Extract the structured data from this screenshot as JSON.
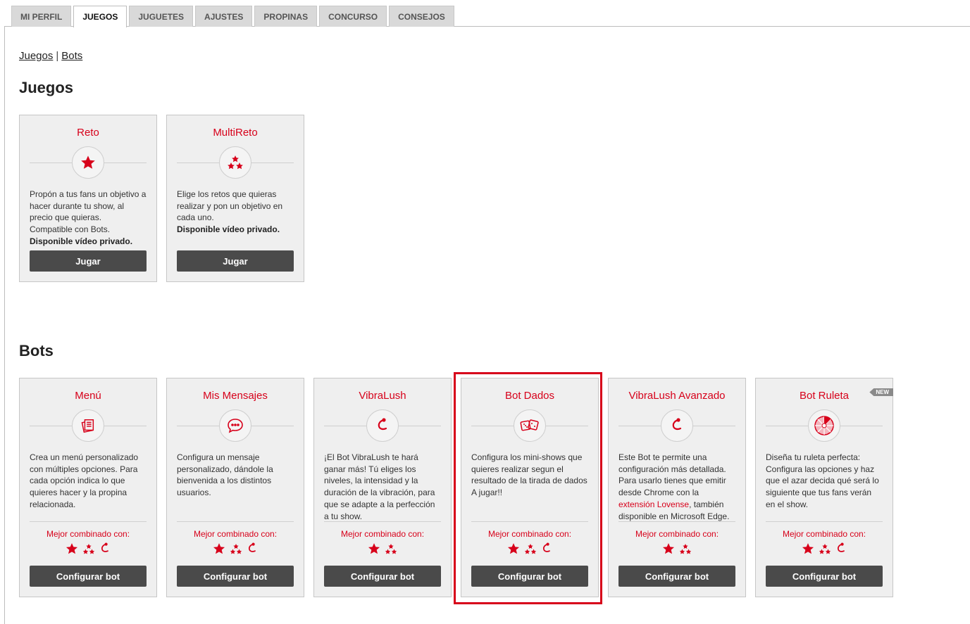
{
  "tabs": [
    "MI PERFIL",
    "JUEGOS",
    "JUGUETES",
    "AJUSTES",
    "PROPINAS",
    "CONCURSO",
    "CONSEJOS"
  ],
  "active_tab": "JUEGOS",
  "breadcrumb": {
    "first": "Juegos",
    "separator": "|",
    "second": "Bots"
  },
  "sections": {
    "games_title": "Juegos",
    "bots_title": "Bots"
  },
  "games": [
    {
      "title": "Reto",
      "icon": "star-icon",
      "text": "Propón a tus fans un objetivo a hacer durante tu show, al precio que quieras. Compatible con Bots.",
      "bold": "Disponible vídeo privado.",
      "button": "Jugar"
    },
    {
      "title": "MultiReto",
      "icon": "three-stars-icon",
      "text": "Elige los retos que quieras realizar y pon un objetivo en cada uno.",
      "bold": "Disponible vídeo privado.",
      "button": "Jugar"
    }
  ],
  "bots": [
    {
      "title": "Menú",
      "icon": "menu-cards-icon",
      "text": "Crea un menú personalizado con múltiples opciones. Para cada opción indica lo que quieres hacer y la propina relacionada.",
      "combo_label": "Mejor combinado con:",
      "combo": [
        "star-icon",
        "three-stars-icon",
        "lush-icon"
      ],
      "button": "Configurar bot"
    },
    {
      "title": "Mis Mensajes",
      "icon": "chat-bubble-icon",
      "text": "Configura un mensaje personalizado, dándole la bienvenida a los distintos usuarios.",
      "combo_label": "Mejor combinado con:",
      "combo": [
        "star-icon",
        "three-stars-icon",
        "lush-icon"
      ],
      "button": "Configurar bot"
    },
    {
      "title": "VibraLush",
      "icon": "lush-icon",
      "text": "¡El Bot VibraLush te hará ganar más! Tú eliges los niveles, la intensidad y la duración de la vibración, para que se adapte a la perfección a tu show.",
      "combo_label": "Mejor combinado con:",
      "combo": [
        "star-icon",
        "three-stars-icon"
      ],
      "button": "Configurar bot"
    },
    {
      "title": "Bot Dados",
      "icon": "dice-icon",
      "text": "Configura los mini-shows que quieres realizar segun el resultado de la tirada de dados A jugar!!",
      "combo_label": "Mejor combinado con:",
      "combo": [
        "star-icon",
        "three-stars-icon",
        "lush-icon"
      ],
      "button": "Configurar bot"
    },
    {
      "title": "VibraLush Avanzado",
      "icon": "lush-icon",
      "text_before": "Este Bot te permite una configuración más detallada. Para usarlo tienes que emitir desde Chrome con la ",
      "link": "extensión Lovense",
      "text_after": ", también disponible en Microsoft Edge.",
      "combo_label": "Mejor combinado con:",
      "combo": [
        "star-icon",
        "three-stars-icon"
      ],
      "button": "Configurar bot"
    },
    {
      "title": "Bot Ruleta",
      "icon": "roulette-icon",
      "badge": "NEW",
      "text": "Diseña tu ruleta perfecta: Configura las opciones y haz que el azar decida qué será lo siguiente que tus fans verán en el show.",
      "combo_label": "Mejor combinado con:",
      "combo": [
        "star-icon",
        "three-stars-icon",
        "lush-icon"
      ],
      "button": "Configurar bot"
    }
  ],
  "colors": {
    "accent": "#d7001a",
    "button": "#4a4a4a",
    "card_bg": "#efefef"
  }
}
